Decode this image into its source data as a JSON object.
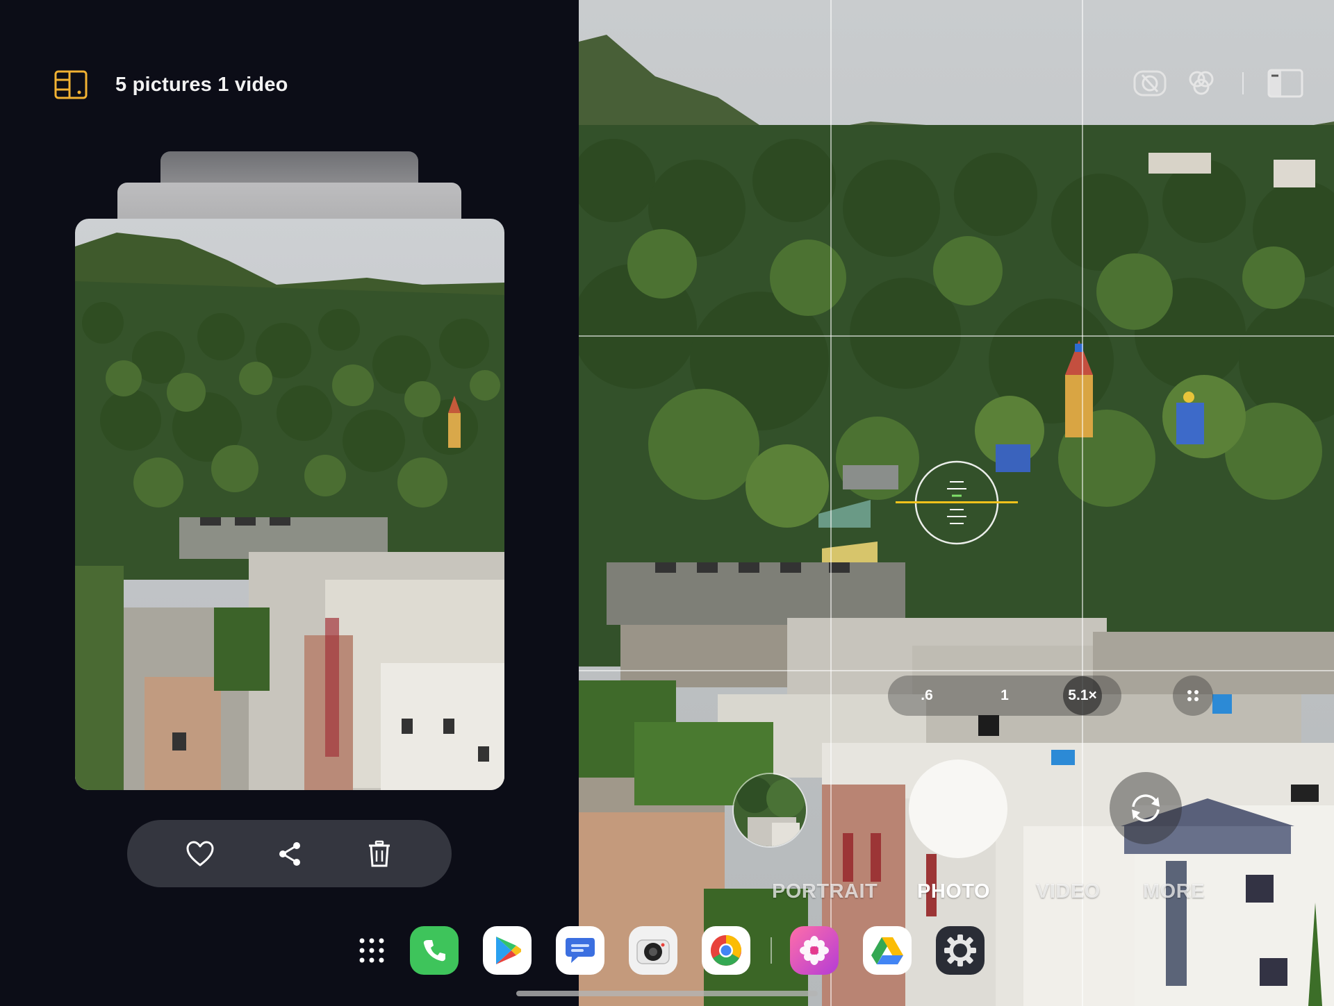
{
  "gallery_panel": {
    "title": "5 pictures 1 video",
    "actions": {
      "favorite_icon": "heart-icon",
      "share_icon": "share-icon",
      "delete_icon": "trash-icon"
    },
    "accent_color": "#f2b233"
  },
  "camera": {
    "top_controls": {
      "motion_photo_icon": "motion-photo-off-icon",
      "filters_icon": "filters-icon",
      "panel_icon": "split-panel-icon"
    },
    "zoom_levels": [
      ".6",
      "1",
      "5.1×"
    ],
    "active_zoom": "5.1×",
    "modes": [
      "PORTRAIT",
      "PHOTO",
      "VIDEO",
      "MORE"
    ],
    "active_mode": "PHOTO",
    "level_color": "#f1c21b"
  },
  "dock": {
    "apps": [
      {
        "name": "App drawer",
        "icon": "app-drawer-icon"
      },
      {
        "name": "Phone",
        "icon": "phone-icon",
        "color": "#3ec45b"
      },
      {
        "name": "Play Store",
        "icon": "play-store-icon"
      },
      {
        "name": "Messages",
        "icon": "messages-icon",
        "color": "#3b6fe0"
      },
      {
        "name": "Camera",
        "icon": "camera-icon"
      },
      {
        "name": "Chrome",
        "icon": "chrome-icon"
      },
      {
        "name": "Gallery",
        "icon": "gallery-icon",
        "color": "#e43a8c"
      },
      {
        "name": "Drive",
        "icon": "drive-icon"
      },
      {
        "name": "Settings",
        "icon": "settings-icon"
      }
    ]
  }
}
